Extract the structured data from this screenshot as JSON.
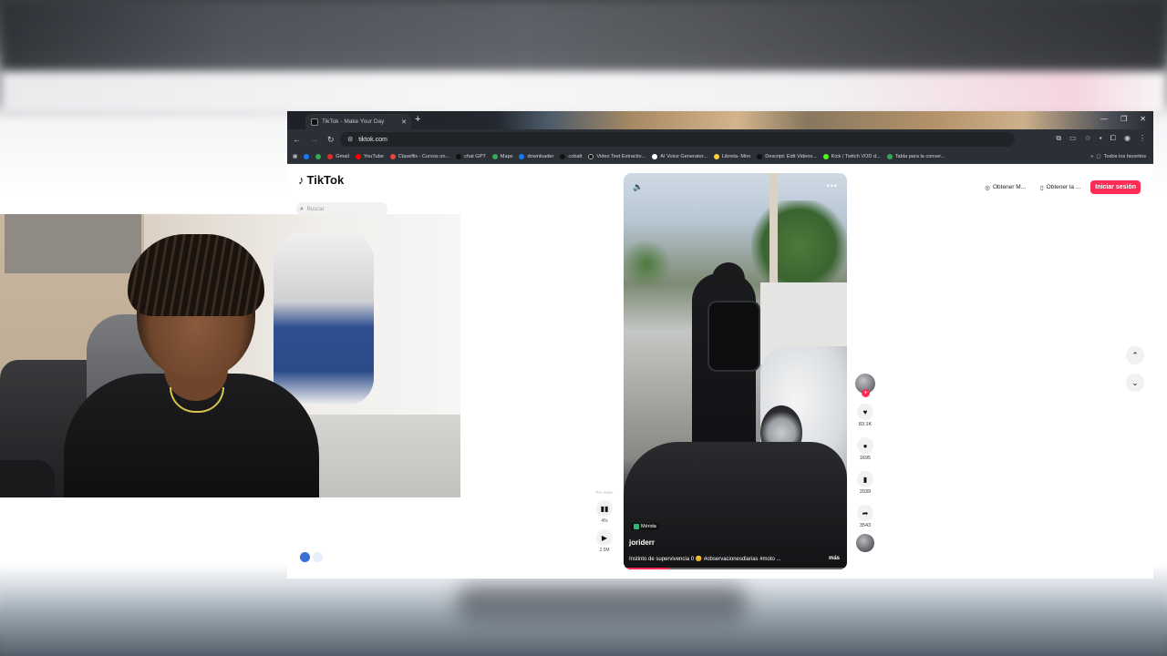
{
  "browser": {
    "tab_title": "TikTok - Make Your Day",
    "address": "tiktok.com",
    "bookmarks": [
      {
        "label": "Gmail",
        "color": "#d93025"
      },
      {
        "label": "YouTube",
        "color": "#ff0000"
      },
      {
        "label": "Claseflix - Cursos on...",
        "color": "#e8453c"
      },
      {
        "label": "chat GPT",
        "color": "#111111"
      },
      {
        "label": "Maps",
        "color": "#34a853"
      },
      {
        "label": "downloader",
        "color": "#1877f2"
      },
      {
        "label": "cobalt",
        "color": "#111111"
      },
      {
        "label": "Video Text Extractio...",
        "color": "#111111"
      },
      {
        "label": "AI Voice Generator...",
        "color": "#ffffff"
      },
      {
        "label": "Libreta- Miro",
        "color": "#ffd02f"
      },
      {
        "label": "Descript: Edit Videos...",
        "color": "#111111"
      },
      {
        "label": "Kick / Twitch VOD d...",
        "color": "#53fc18"
      },
      {
        "label": "Tabla para la conver...",
        "color": "#34a853"
      }
    ],
    "all_bookmarks_label": "Todos los favoritos"
  },
  "tiktok": {
    "logo_text": "TikTok",
    "search_placeholder": "Buscar",
    "header_buttons": [
      "Obtener M...",
      "Obtener la ..."
    ],
    "login_label": "Iniciar sesión",
    "video": {
      "location": "Mérida",
      "author": "joriderr",
      "caption": "Instinto de supervivencia 0 😊 #observacionesdiarias #moto ...",
      "more_label": "más",
      "progress": 0.2
    },
    "side": {
      "label": "Pro votes",
      "percent": "4%",
      "views": "2.5M"
    },
    "actions": {
      "likes": "83.1K",
      "comments": "1695",
      "saves": "2039",
      "shares": "3543"
    }
  },
  "colors": {
    "accent": "#fe2c55",
    "chrome_bg": "#2b2f36"
  }
}
